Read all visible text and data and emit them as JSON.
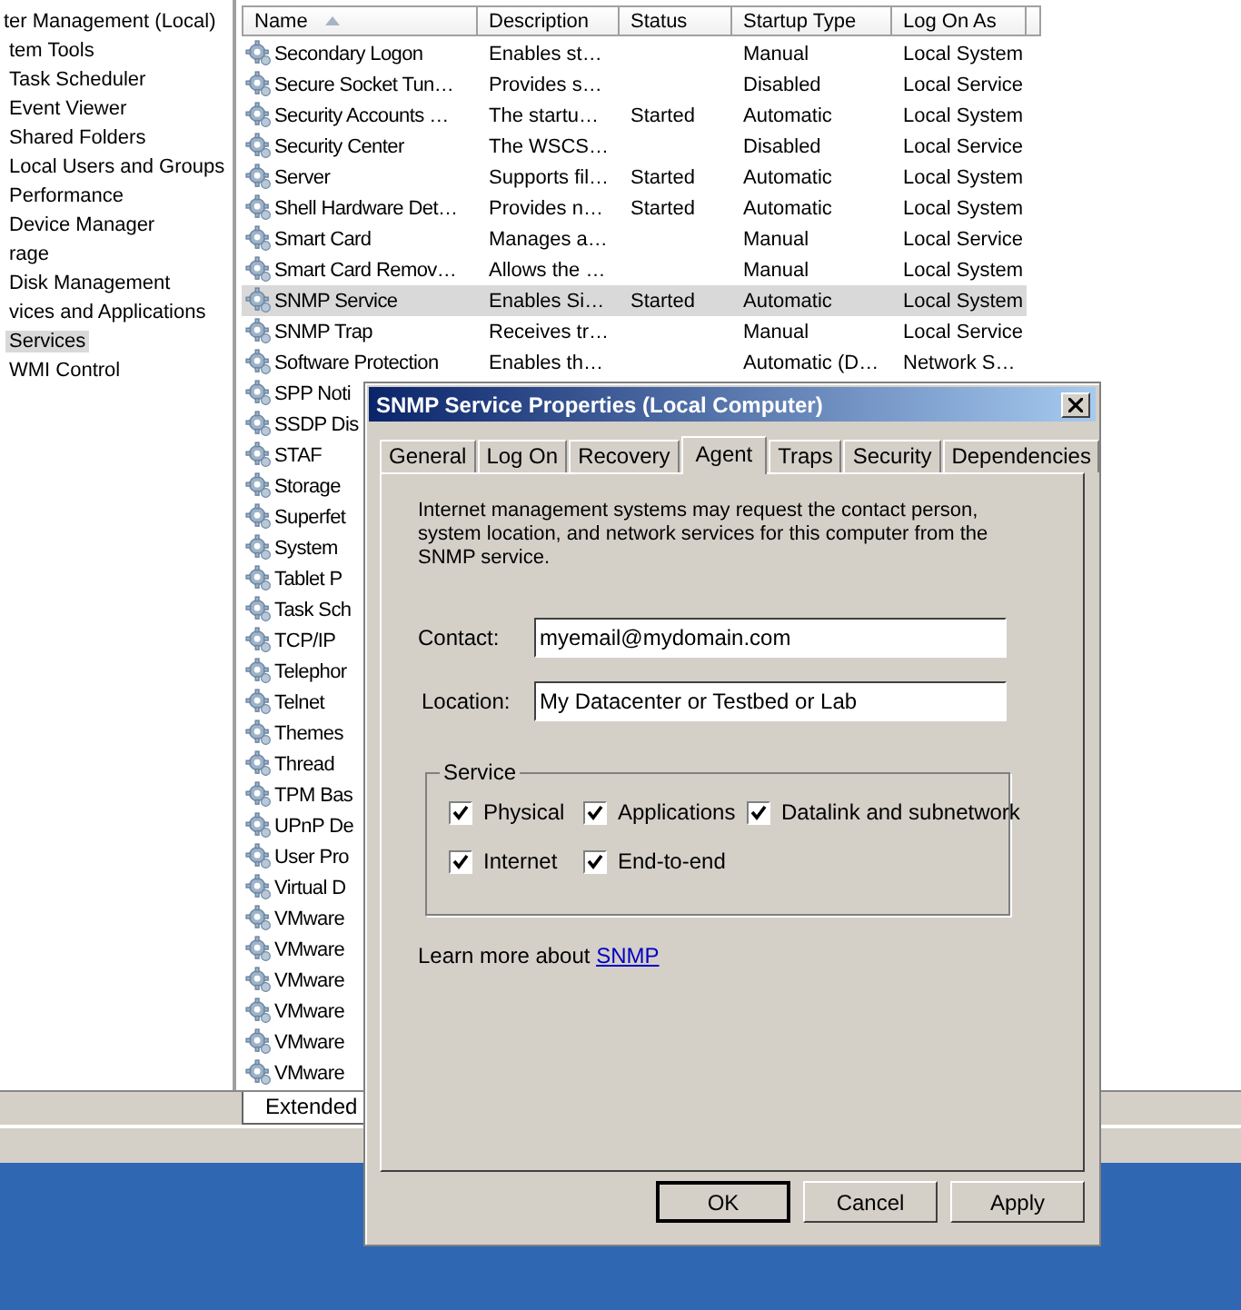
{
  "tree": {
    "items": [
      {
        "label": "ter Management (Local)",
        "selected": false,
        "children": [
          {
            "label": "tem Tools",
            "selected": false,
            "children": [
              {
                "label": "Task Scheduler",
                "selected": false
              },
              {
                "label": "Event Viewer",
                "selected": false
              },
              {
                "label": "Shared Folders",
                "selected": false
              },
              {
                "label": "Local Users and Groups",
                "selected": false
              },
              {
                "label": "Performance",
                "selected": false
              },
              {
                "label": "Device Manager",
                "selected": false
              }
            ]
          },
          {
            "label": "rage",
            "selected": false,
            "children": [
              {
                "label": "Disk Management",
                "selected": false
              }
            ]
          },
          {
            "label": "vices and Applications",
            "selected": false,
            "children": [
              {
                "label": "Services",
                "selected": true
              },
              {
                "label": "WMI Control",
                "selected": false
              }
            ]
          }
        ]
      }
    ]
  },
  "services_table": {
    "columns": [
      {
        "label": "Name",
        "sorted": true
      },
      {
        "label": "Description",
        "sorted": false
      },
      {
        "label": "Status",
        "sorted": false
      },
      {
        "label": "Startup Type",
        "sorted": false
      },
      {
        "label": "Log On As",
        "sorted": false
      }
    ],
    "rows": [
      {
        "name": "Secondary Logon",
        "description": "Enables st…",
        "startup_type": "Manual",
        "log_on_as": "Local System",
        "selected": false
      },
      {
        "name": "Secure Socket Tun…",
        "description": "Provides s…",
        "startup_type": "Disabled",
        "log_on_as": "Local Service",
        "selected": false
      },
      {
        "name": "Security Accounts …",
        "description": "The startu…",
        "status": "Started",
        "startup_type": "Automatic",
        "log_on_as": "Local System",
        "selected": false
      },
      {
        "name": "Security Center",
        "description": "The WSCS…",
        "startup_type": "Disabled",
        "log_on_as": "Local Service",
        "selected": false
      },
      {
        "name": "Server",
        "description": "Supports fil…",
        "status": "Started",
        "startup_type": "Automatic",
        "log_on_as": "Local System",
        "selected": false
      },
      {
        "name": "Shell Hardware Det…",
        "description": "Provides n…",
        "status": "Started",
        "startup_type": "Automatic",
        "log_on_as": "Local System",
        "selected": false
      },
      {
        "name": "Smart Card",
        "description": "Manages a…",
        "startup_type": "Manual",
        "log_on_as": "Local Service",
        "selected": false
      },
      {
        "name": "Smart Card Remov…",
        "description": "Allows the …",
        "startup_type": "Manual",
        "log_on_as": "Local System",
        "selected": false
      },
      {
        "name": "SNMP Service",
        "description": "Enables Si…",
        "status": "Started",
        "startup_type": "Automatic",
        "log_on_as": "Local System",
        "selected": true
      },
      {
        "name": "SNMP Trap",
        "description": "Receives tr…",
        "startup_type": "Manual",
        "log_on_as": "Local Service",
        "selected": false
      },
      {
        "name": "Software Protection",
        "description": "Enables th…",
        "startup_type": "Automatic (D…",
        "log_on_as": "Network S…",
        "selected": false
      },
      {
        "name": "SPP Noti",
        "selected": false
      },
      {
        "name": "SSDP Dis",
        "selected": false
      },
      {
        "name": "STAF",
        "selected": false
      },
      {
        "name": "Storage",
        "selected": false
      },
      {
        "name": "Superfet",
        "selected": false
      },
      {
        "name": "System",
        "selected": false
      },
      {
        "name": "Tablet P",
        "selected": false
      },
      {
        "name": "Task Sch",
        "selected": false
      },
      {
        "name": "TCP/IP",
        "selected": false
      },
      {
        "name": "Telephor",
        "selected": false
      },
      {
        "name": "Telnet",
        "selected": false
      },
      {
        "name": "Themes",
        "selected": false
      },
      {
        "name": "Thread",
        "selected": false
      },
      {
        "name": "TPM Bas",
        "selected": false
      },
      {
        "name": "UPnP De",
        "selected": false
      },
      {
        "name": "User Pro",
        "selected": false
      },
      {
        "name": "Virtual D",
        "selected": false
      },
      {
        "name": "VMware",
        "selected": false
      },
      {
        "name": "VMware",
        "selected": false
      },
      {
        "name": "VMware",
        "selected": false
      },
      {
        "name": "VMware",
        "selected": false
      },
      {
        "name": "VMware",
        "selected": false
      },
      {
        "name": "VMware",
        "selected": false
      }
    ]
  },
  "view_tabs": [
    {
      "label": "Extended",
      "selected": true
    }
  ],
  "dialog": {
    "title": "SNMP Service Properties (Local Computer)",
    "tabs": [
      {
        "label": "General",
        "selected": false
      },
      {
        "label": "Log On",
        "selected": false
      },
      {
        "label": "Recovery",
        "selected": false
      },
      {
        "label": "Agent",
        "selected": true
      },
      {
        "label": "Traps",
        "selected": false
      },
      {
        "label": "Security",
        "selected": false
      },
      {
        "label": "Dependencies",
        "selected": false
      }
    ],
    "intro": "Internet management systems may request the contact person, system location, and network services for this computer from the SNMP service.",
    "contact": {
      "label": "Contact:",
      "value": "myemail@mydomain.com"
    },
    "location": {
      "label": "Location:",
      "value": "My Datacenter or Testbed or Lab"
    },
    "service_group": {
      "title": "Service",
      "options": [
        {
          "label": "Physical",
          "checked": true
        },
        {
          "label": "Applications",
          "checked": true
        },
        {
          "label": "Datalink and subnetwork",
          "checked": true
        },
        {
          "label": "Internet",
          "checked": true
        },
        {
          "label": "End-to-end",
          "checked": true
        }
      ]
    },
    "learn_more": {
      "text": "Learn more about",
      "link": "SNMP"
    },
    "buttons": [
      {
        "label": "OK",
        "default": true
      },
      {
        "label": "Cancel",
        "default": false
      },
      {
        "label": "Apply",
        "default": false
      }
    ]
  }
}
